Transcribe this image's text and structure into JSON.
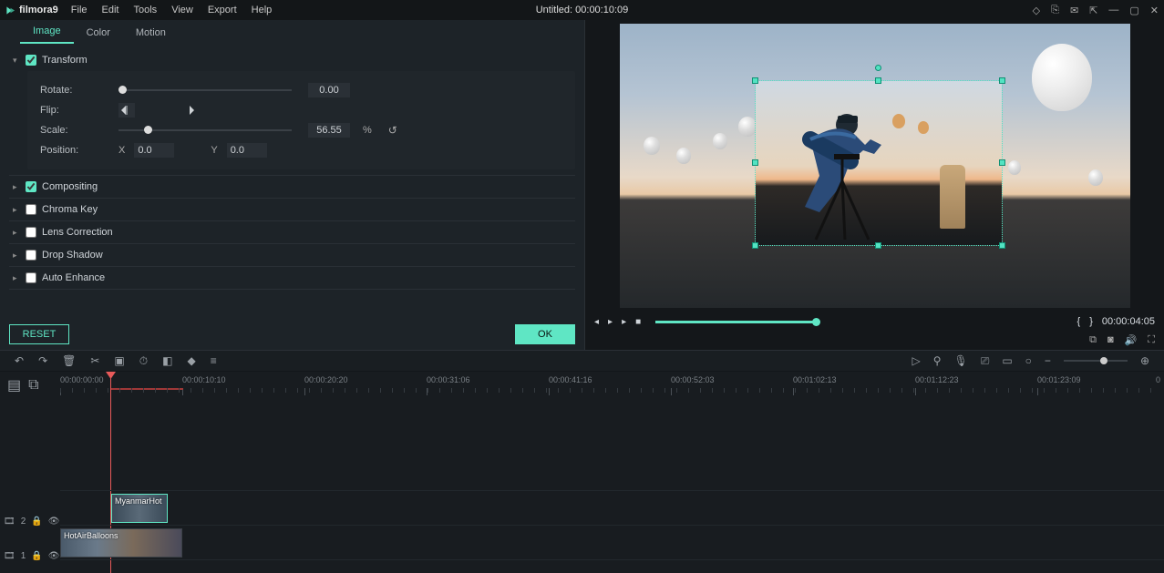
{
  "app": {
    "name": "filmora9"
  },
  "menubar": [
    "File",
    "Edit",
    "Tools",
    "View",
    "Export",
    "Help"
  ],
  "project_title": "Untitled:",
  "project_timecode": "00:00:10:09",
  "tabs": {
    "items": [
      "Image",
      "Color",
      "Motion"
    ],
    "active": 0
  },
  "sections": {
    "transform": {
      "label": "Transform",
      "checked": true,
      "expanded": true,
      "rotate": {
        "label": "Rotate:",
        "value": "0.00"
      },
      "flip": {
        "label": "Flip:"
      },
      "scale": {
        "label": "Scale:",
        "value": "56.55",
        "percent_symbol": "%"
      },
      "position": {
        "label": "Position:",
        "x_label": "X",
        "x": "0.0",
        "y_label": "Y",
        "y": "0.0"
      }
    },
    "compositing": {
      "label": "Compositing",
      "checked": true,
      "expanded": false
    },
    "chroma_key": {
      "label": "Chroma Key",
      "checked": false,
      "expanded": false
    },
    "lens_correction": {
      "label": "Lens Correction",
      "checked": false,
      "expanded": false
    },
    "drop_shadow": {
      "label": "Drop Shadow",
      "checked": false,
      "expanded": false
    },
    "auto_enhance": {
      "label": "Auto Enhance",
      "checked": false,
      "expanded": false
    }
  },
  "buttons": {
    "reset": "RESET",
    "ok": "OK"
  },
  "preview": {
    "timecode": "00:00:04:05",
    "markers": {
      "left": "{",
      "right": "}"
    }
  },
  "timeline": {
    "ruler": [
      "00:00:00:00",
      "00:00:10:10",
      "00:00:20:20",
      "00:00:31:06",
      "00:00:41:16",
      "00:00:52:03",
      "00:01:02:13",
      "00:01:12:23",
      "00:01:23:09"
    ],
    "ruler_end": "0",
    "tracks": [
      {
        "id": "2",
        "label": "2"
      },
      {
        "id": "1",
        "label": "1"
      }
    ],
    "clips": [
      {
        "name": "MyanmarHot"
      },
      {
        "name": "HotAirBalloons"
      }
    ]
  }
}
